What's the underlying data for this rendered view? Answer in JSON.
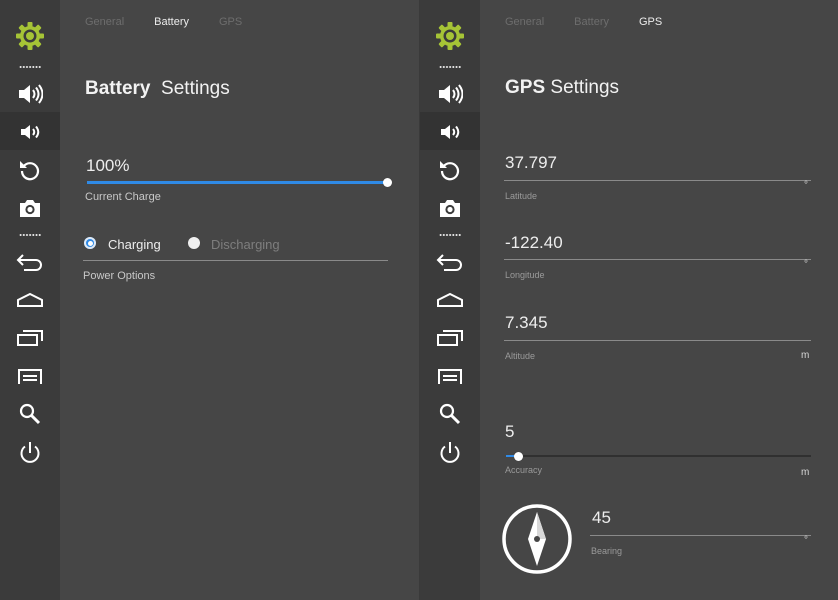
{
  "colors": {
    "accent": "#2f8ae6",
    "gear": "#a6c436",
    "panel": "#464646",
    "sidebar": "#3b3b3b"
  },
  "icons": [
    "gear-icon",
    "volume-up-icon",
    "volume-down-icon",
    "rotate-icon",
    "camera-icon",
    "back-icon",
    "home-icon",
    "recent-apps-icon",
    "menu-icon",
    "search-icon",
    "power-icon"
  ],
  "left": {
    "tabs": [
      "General",
      "Battery",
      "GPS"
    ],
    "active_tab": "Battery",
    "title_bold": "Battery",
    "title_rest": "Settings",
    "charge": {
      "value": "100%",
      "label": "Current Charge",
      "level": 1.0
    },
    "power": {
      "options": [
        "Charging",
        "Discharging"
      ],
      "selected": "Charging",
      "label": "Power Options"
    }
  },
  "right": {
    "tabs": [
      "General",
      "Battery",
      "GPS"
    ],
    "active_tab": "GPS",
    "title_bold": "GPS",
    "title_rest": "Settings",
    "latitude": {
      "value": "37.797",
      "label": "Latitude",
      "unit": "°"
    },
    "longitude": {
      "value": "-122.40",
      "label": "Longitude",
      "unit": "°"
    },
    "altitude": {
      "value": "7.345",
      "label": "Altitude",
      "unit": "m"
    },
    "accuracy": {
      "value": "5",
      "label": "Accuracy",
      "unit": "m",
      "level": 0.04
    },
    "bearing": {
      "value": "45",
      "label": "Bearing",
      "unit": "°"
    }
  }
}
